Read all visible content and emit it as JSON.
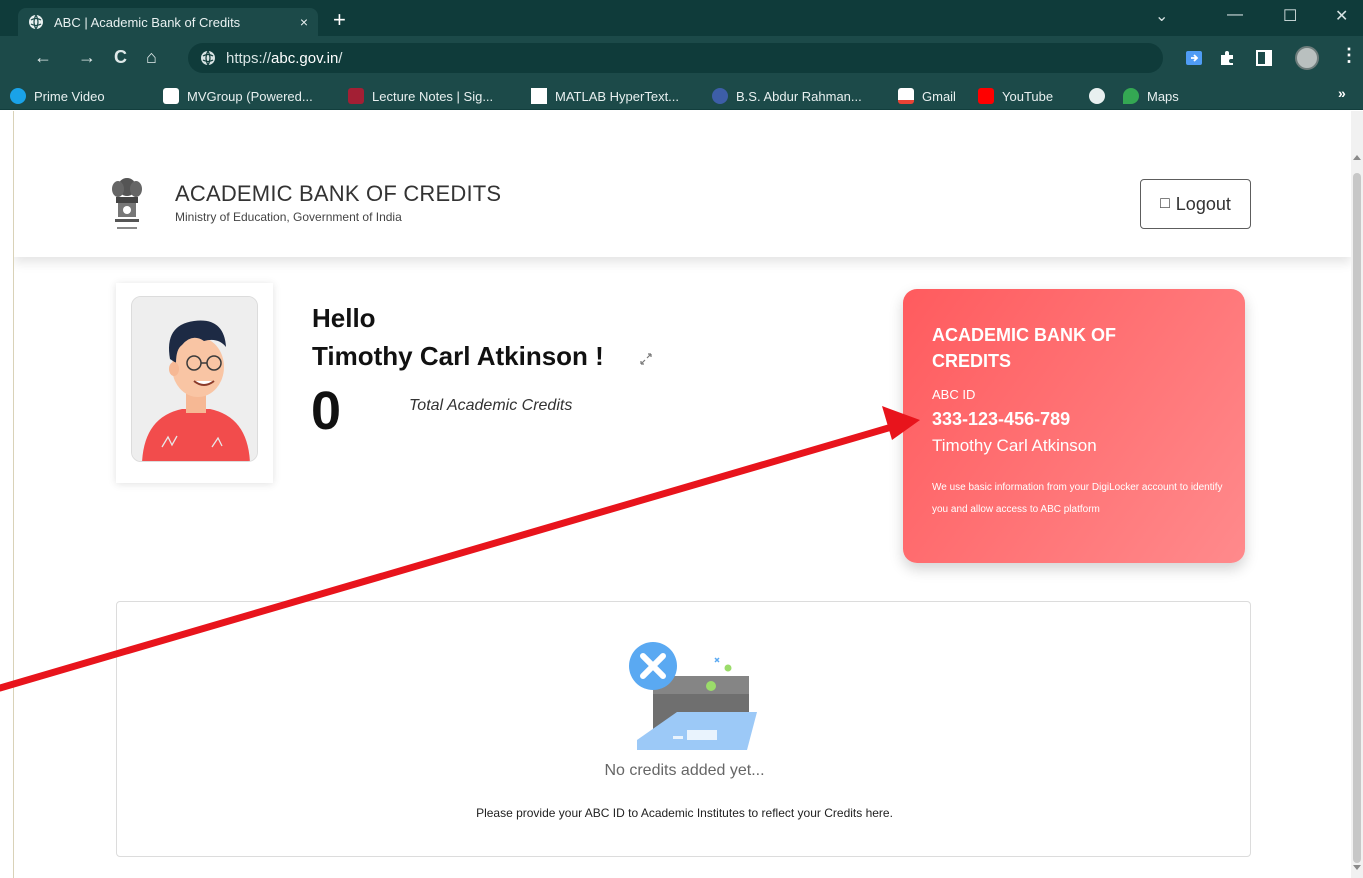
{
  "browser": {
    "tab_title": "ABC | Academic Bank of Credits",
    "tab_close": "×",
    "new_tab": "+",
    "url_scheme": "https://",
    "url_host": "abc.gov.in",
    "url_path": "/",
    "window_controls": [
      "⌄",
      "—",
      "☐",
      "✕"
    ],
    "bookmarks": [
      {
        "label": "Prime Video",
        "icon": "prime-video-icon"
      },
      {
        "label": "MVGroup (Powered...",
        "icon": "mvgroup-icon"
      },
      {
        "label": "Lecture Notes | Sig...",
        "icon": "mit-ocw-icon"
      },
      {
        "label": "MATLAB HyperText...",
        "icon": "blank-page-icon"
      },
      {
        "label": "B.S. Abdur Rahman...",
        "icon": "university-icon"
      },
      {
        "label": "Gmail",
        "icon": "gmail-icon"
      },
      {
        "label": "YouTube",
        "icon": "youtube-icon"
      },
      {
        "label": "",
        "icon": "globe-icon"
      },
      {
        "label": "Maps",
        "icon": "maps-icon"
      }
    ],
    "bookmarks_more": "»"
  },
  "header": {
    "title": "ACADEMIC BANK OF CREDITS",
    "subtitle": "Ministry of Education, Government of India",
    "logout_icon": "□",
    "logout_label": "Logout"
  },
  "profile": {
    "greeting": "Hello",
    "name": "Timothy Carl Atkinson !",
    "credits_value": "0",
    "credits_label": "Total Academic Credits"
  },
  "abc_card": {
    "title": "ACADEMIC BANK OF CREDITS",
    "id_label": "ABC ID",
    "id_value": "333-123-456-789",
    "holder_name": "Timothy Carl Atkinson",
    "info": "We use basic information from your DigiLocker account to identify you and allow access to ABC platform"
  },
  "credits_panel": {
    "empty_title": "No credits added yet...",
    "empty_desc": "Please provide your ABC ID to Academic Institutes to reflect your Credits here."
  },
  "colors": {
    "chrome_dark": "#0f3b3a",
    "chrome_toolbar": "#1c4a49",
    "card_gradient_start": "#ff5b5e",
    "card_gradient_end": "#ff8a8c",
    "annotation_arrow": "#e8141c"
  }
}
